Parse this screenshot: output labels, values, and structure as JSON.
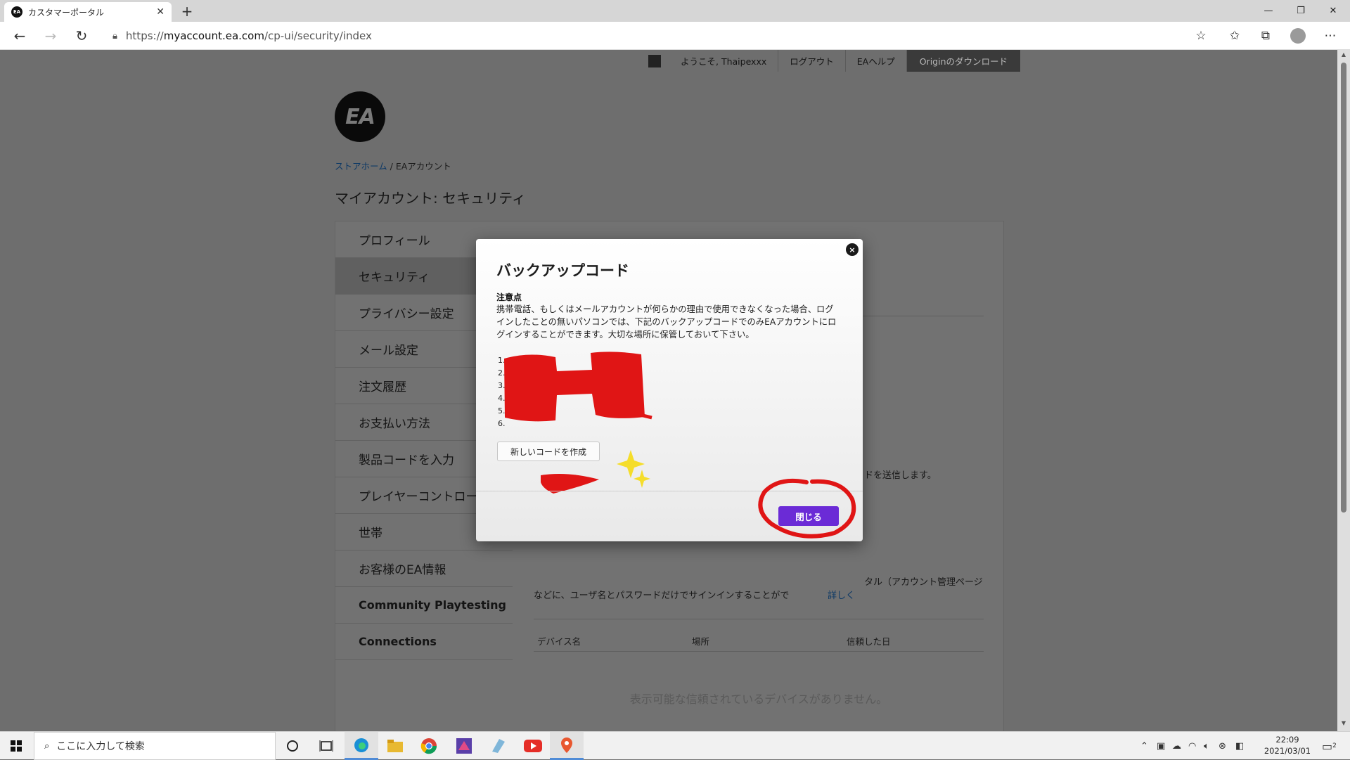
{
  "browser": {
    "tab_title": "カスタマーポータル",
    "tab_favicon": "EA",
    "url_prefix": "https://",
    "url_domain": "myaccount.ea.com",
    "url_path": "/cp-ui/security/index"
  },
  "topnav": {
    "welcome": "ようこそ, Thaipexxx",
    "logout": "ログアウト",
    "help": "EAヘルプ",
    "download": "Originのダウンロード"
  },
  "logo_text": "EA",
  "breadcrumb": {
    "home": "ストアホーム",
    "separator": " / ",
    "current": "EAアカウント"
  },
  "page_title": "マイアカウント: セキュリティ",
  "sidebar": {
    "items": [
      {
        "label": "プロフィール"
      },
      {
        "label": "セキュリティ"
      },
      {
        "label": "プライバシー設定"
      },
      {
        "label": "メール設定"
      },
      {
        "label": "注文履歴"
      },
      {
        "label": "お支払い方法"
      },
      {
        "label": "製品コードを入力"
      },
      {
        "label": "プレイヤーコントロール"
      },
      {
        "label": "世帯"
      },
      {
        "label": "お客様のEA情報"
      },
      {
        "label": "Community Playtesting"
      },
      {
        "label": "Connections"
      }
    ]
  },
  "background": {
    "send_code_fragment": "ドを送信します。",
    "trusted_fragment_1": "タル（アカウント管理ページ",
    "trusted_fragment_2": "などに、ユーザ名とパスワードだけでサインインすることがで",
    "trusted_link_fragment": "詳しく",
    "table_headers": [
      "デバイス名",
      "場所",
      "信頼した日"
    ],
    "empty_message": "表示可能な信頼されているデバイスがありません。"
  },
  "modal": {
    "title": "バックアップコード",
    "note_heading": "注意点",
    "note_body": "携帯電話、もしくはメールアカウントが何らかの理由で使用できなくなった場合、ログインしたことの無いパソコンでは、下記のバックアップコードでのみEAアカウントにログインすることができます。大切な場所に保管しておいて下さい。",
    "codes": [
      "1.",
      "2.",
      "3.",
      "4.",
      "5.",
      "6."
    ],
    "new_code_button": "新しいコードを作成",
    "close_button": "閉じる",
    "close_icon": "×"
  },
  "taskbar": {
    "search_placeholder": "ここに入力して検索",
    "time": "22:09",
    "date": "2021/03/01",
    "notification_count": "2"
  },
  "colors": {
    "close_button": "#6b2bd6",
    "annotation_red": "#e01515",
    "sparkle_yellow": "#f5dd2a"
  }
}
